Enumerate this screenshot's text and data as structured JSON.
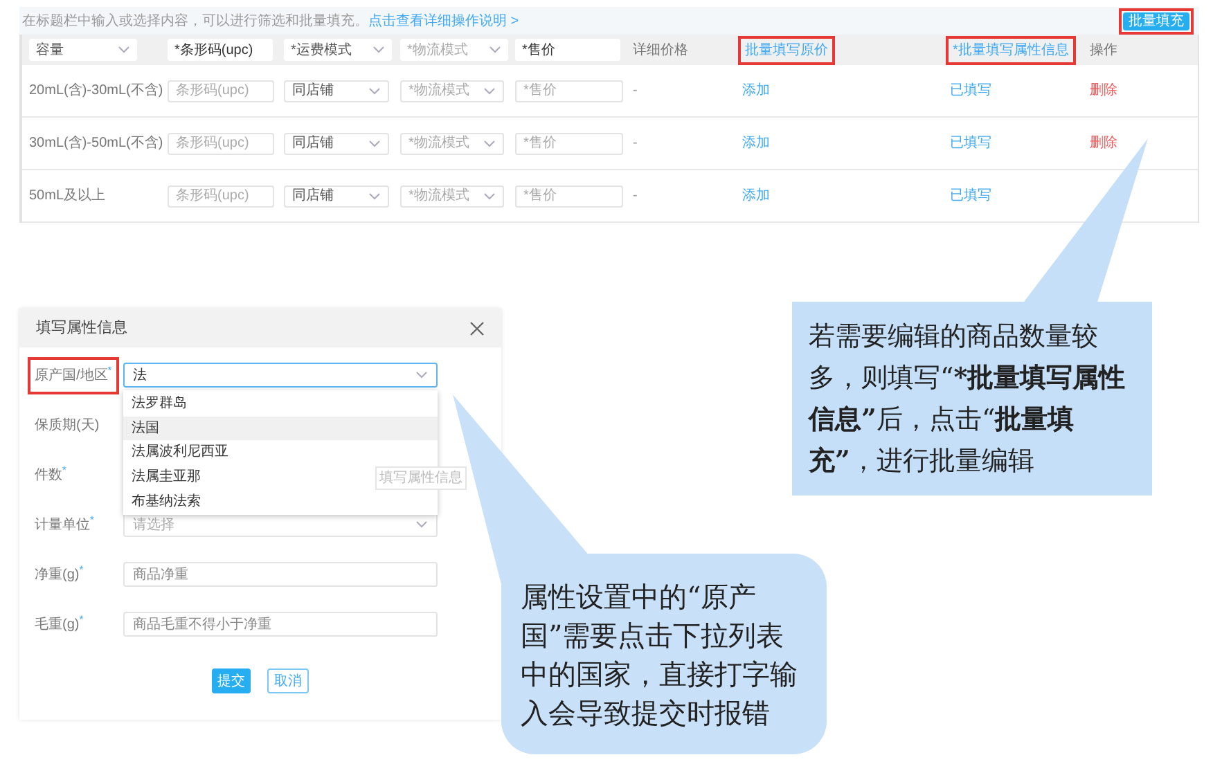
{
  "notice": {
    "text": "在标题栏中输入或选择内容，可以进行筛选和批量填充。",
    "link": "点击查看详细操作说明 >"
  },
  "batch_fill_button": {
    "label": "批量填充",
    "highlighted": true
  },
  "header": [
    {
      "kind": "select",
      "text": "容量",
      "highlighted": false
    },
    {
      "kind": "input",
      "text": "*条形码(upc)",
      "highlighted": false
    },
    {
      "kind": "select",
      "text": "*运费模式",
      "highlighted": false
    },
    {
      "kind": "select-placeholder",
      "text": "*物流模式",
      "highlighted": false
    },
    {
      "kind": "input",
      "text": "*售价",
      "highlighted": false
    },
    {
      "kind": "text",
      "text": "详细价格",
      "highlighted": false
    },
    {
      "kind": "link",
      "text": "批量填写原价",
      "highlighted": true
    },
    {
      "kind": "link",
      "text": "*批量填写属性信息",
      "highlighted": true
    },
    {
      "kind": "text",
      "text": "操作",
      "highlighted": false
    }
  ],
  "rows": [
    {
      "spec": "20mL(含)-30mL(不含)",
      "upc_placeholder": "条形码(upc)",
      "shipping": "同店铺",
      "logistics_placeholder": "*物流模式",
      "price_placeholder": "*售价",
      "detail_price": "-",
      "original_price_action": "添加",
      "attributes_status": "已填写",
      "delete_action": "删除"
    },
    {
      "spec": "30mL(含)-50mL(不含)",
      "upc_placeholder": "条形码(upc)",
      "shipping": "同店铺",
      "logistics_placeholder": "*物流模式",
      "price_placeholder": "*售价",
      "detail_price": "-",
      "original_price_action": "添加",
      "attributes_status": "已填写",
      "delete_action": "删除"
    },
    {
      "spec": "50mL及以上",
      "upc_placeholder": "条形码(upc)",
      "shipping": "同店铺",
      "logistics_placeholder": "*物流模式",
      "price_placeholder": "*售价",
      "detail_price": "-",
      "original_price_action": "添加",
      "attributes_status": "已填写"
    }
  ],
  "dialog": {
    "title": "填写属性信息",
    "fields": [
      {
        "label": "原产国/地区",
        "required_mark": "*",
        "highlighted": true,
        "kind": "select",
        "value": "法"
      },
      {
        "label": "保质期(天)",
        "highlighted": false,
        "kind": "covered"
      },
      {
        "label": "件数",
        "required_mark": "*",
        "highlighted": false,
        "kind": "covered"
      },
      {
        "label": "计量单位",
        "required_mark": "*",
        "highlighted": false,
        "kind": "select",
        "placeholder": "请选择"
      },
      {
        "label": "净重(g)",
        "required_mark": "*",
        "highlighted": false,
        "kind": "input",
        "placeholder": "商品净重"
      },
      {
        "label": "毛重(g)",
        "required_mark": "*",
        "highlighted": false,
        "kind": "input",
        "placeholder": "商品毛重不得小于净重"
      }
    ],
    "dropdown_options": [
      {
        "text": "法罗群岛",
        "selected": false
      },
      {
        "text": "法国",
        "selected": true
      },
      {
        "text": "法属波利尼西亚",
        "selected": false
      },
      {
        "text": "法属圭亚那",
        "selected": false
      },
      {
        "text": "布基纳法索",
        "selected": false
      }
    ],
    "tooltip": "填写属性信息",
    "buttons": [
      {
        "label": "提交",
        "kind": "primary"
      },
      {
        "label": "取消",
        "kind": "secondary"
      }
    ]
  },
  "callouts": [
    {
      "segments": [
        {
          "text": "若需要编辑的商品数量较多，则填写“",
          "bold": false
        },
        {
          "text": "*批量填写属性信息”",
          "bold": true
        },
        {
          "text": "后，点击“",
          "bold": false
        },
        {
          "text": "批量填充”",
          "bold": true
        },
        {
          "text": "，进行批量编辑",
          "bold": false
        }
      ]
    },
    {
      "segments": [
        {
          "text": "属性设置中的“原产国”需要点击下拉列表中的国家，直接打字输入会导致提交时报错",
          "bold": false
        }
      ]
    }
  ]
}
